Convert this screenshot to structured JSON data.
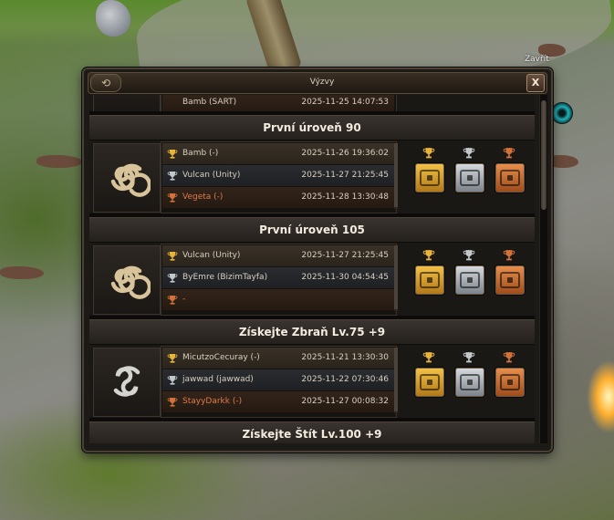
{
  "window": {
    "title": "Výzvy",
    "close_label": "X",
    "refresh_label": "⟲"
  },
  "tooltip": {
    "close": "Zavřít"
  },
  "partial_top_row": {
    "name": "Bamb (SART)",
    "date": "2025-11-25 14:07:53"
  },
  "sections": [
    {
      "title": "První úroveň 90",
      "emblem": "triple-spiral-gold",
      "ranks": [
        {
          "place": "gold",
          "name": "Bamb (-)",
          "date": "2025-11-26 19:36:02"
        },
        {
          "place": "silver",
          "name": "Vulcan (Unity)",
          "date": "2025-11-27 21:25:45"
        },
        {
          "place": "bronze",
          "name": "Vegeta (-)",
          "date": "2025-11-28 13:30:48"
        }
      ]
    },
    {
      "title": "První úroveň 105",
      "emblem": "triple-spiral-gold",
      "ranks": [
        {
          "place": "gold",
          "name": "Vulcan (Unity)",
          "date": "2025-11-27 21:25:45"
        },
        {
          "place": "silver",
          "name": "ByEmre (BizimTayfa)",
          "date": "2025-11-30 04:54:45"
        },
        {
          "place": "bronze",
          "name": "-",
          "date": ""
        }
      ]
    },
    {
      "title": "Získejte Zbraň Lv.75 +9",
      "emblem": "double-spiral-silver",
      "ranks": [
        {
          "place": "gold",
          "name": "MicutzoCecuray (-)",
          "date": "2025-11-21 13:30:30"
        },
        {
          "place": "silver",
          "name": "jawwad (jawwad)",
          "date": "2025-11-22 07:30:46"
        },
        {
          "place": "bronze",
          "name": "StayyDarkk (-)",
          "date": "2025-11-27 00:08:32"
        }
      ]
    },
    {
      "title": "Získejte Štít Lv.100 +9",
      "emblem": "none",
      "ranks": []
    }
  ],
  "colors": {
    "gold": "#e8b43a",
    "silver": "#c4c8cc",
    "bronze": "#d0723a",
    "header_text": "#f2ece0"
  }
}
